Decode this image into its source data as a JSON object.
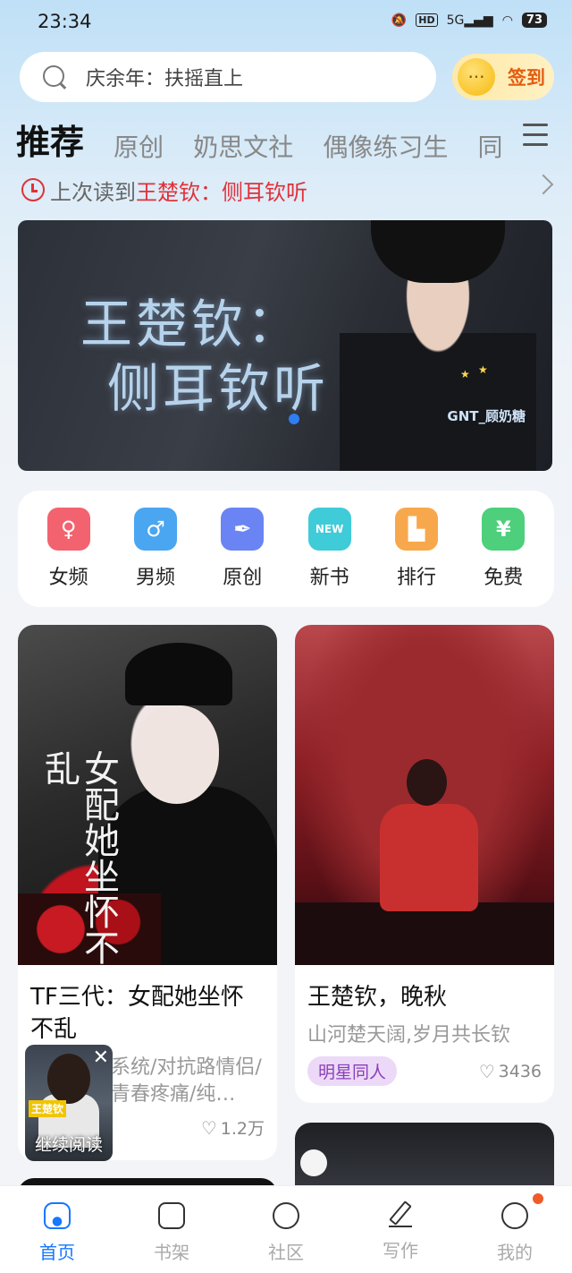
{
  "status_bar": {
    "time": "23:34",
    "network": "5G",
    "hd": "HD",
    "battery": "73"
  },
  "search": {
    "text": "庆余年：扶摇直上",
    "icon": "search-icon"
  },
  "checkin": {
    "label": "签到",
    "icon": "coin-smile-icon"
  },
  "tabs": [
    {
      "label": "推荐",
      "active": true
    },
    {
      "label": "原创"
    },
    {
      "label": "奶思文社"
    },
    {
      "label": "偶像练习生"
    },
    {
      "label": "同"
    }
  ],
  "last_read": {
    "prefix": "上次读到",
    "title": "王楚钦：侧耳钦听"
  },
  "banner": {
    "title_line1": "王楚钦：",
    "title_line2": "侧耳钦听",
    "watermark": "GNT_顾奶糖"
  },
  "categories": [
    {
      "label": "女频",
      "icon": "female-icon",
      "color": "#f2636f"
    },
    {
      "label": "男频",
      "icon": "male-icon",
      "color": "#4aa6f0"
    },
    {
      "label": "原创",
      "icon": "pen-nib-icon",
      "color": "#6a84f3"
    },
    {
      "label": "新书",
      "icon": "new-book-icon",
      "color": "#3fcbd8"
    },
    {
      "label": "排行",
      "icon": "podium-icon",
      "color": "#f8a84c"
    },
    {
      "label": "免费",
      "icon": "yen-icon",
      "color": "#4dcf7b"
    }
  ],
  "books": [
    {
      "title": "TF三代：女配她坐怀不乱",
      "desc": "系统/对抗路情侣/青春疼痛/纯…",
      "likes": "1.2万",
      "cover_text": "女配她坐怀不乱"
    },
    {
      "title": "王楚钦，晚秋",
      "desc": "山河楚天阔,岁月共长钦",
      "tag": "明星同人",
      "likes": "3436"
    }
  ],
  "float_continue": {
    "label": "继续阅读",
    "badge": "王楚钦"
  },
  "nav": [
    {
      "label": "首页",
      "active": true
    },
    {
      "label": "书架"
    },
    {
      "label": "社区"
    },
    {
      "label": "写作"
    },
    {
      "label": "我的",
      "badge": true
    }
  ]
}
